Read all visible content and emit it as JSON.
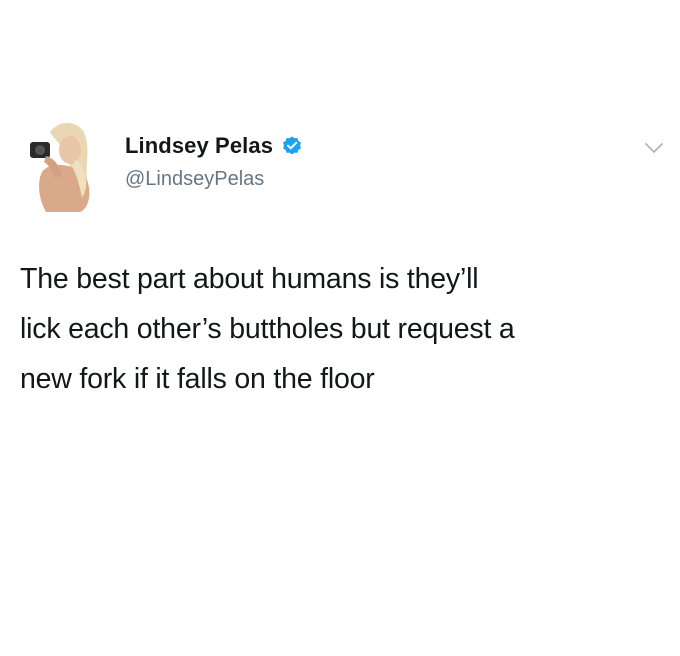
{
  "author": {
    "display_name": "Lindsey Pelas",
    "handle": "@LindseyPelas",
    "verified_icon": "verified-badge-icon",
    "avatar": "profile-photo"
  },
  "menu": {
    "icon": "chevron-down-icon"
  },
  "tweet": {
    "lines": [
      "The best part about humans is they’ll",
      "lick each other’s buttholes but request a",
      "new fork if it falls on the floor"
    ]
  },
  "colors": {
    "name": "#14171a",
    "handle": "#657786",
    "verified": "#1da1f2",
    "chevron": "#aab8c2",
    "background": "#ffffff"
  }
}
